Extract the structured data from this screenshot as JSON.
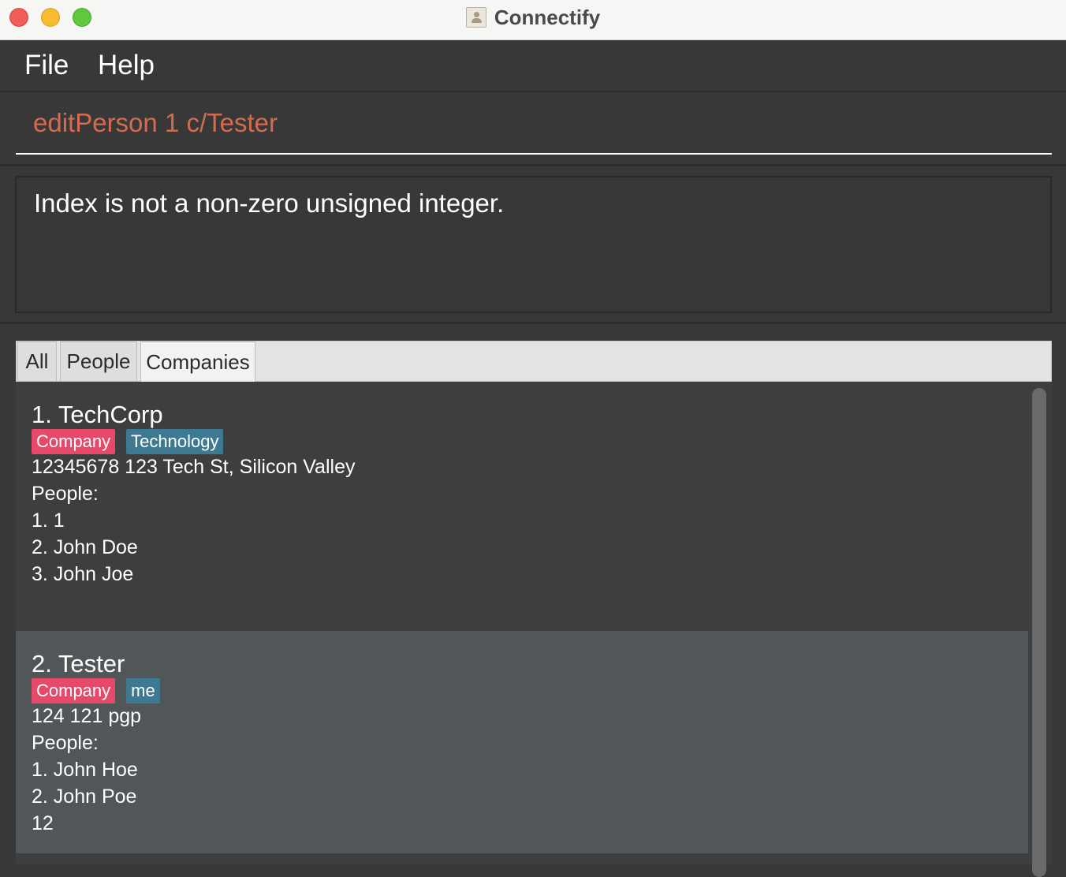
{
  "window": {
    "title": "Connectify",
    "controls": [
      "close",
      "minimize",
      "maximize"
    ]
  },
  "menu": {
    "file": "File",
    "help": "Help"
  },
  "command": {
    "value": "editPerson 1 c/Tester"
  },
  "result": {
    "message": "Index is not a non-zero unsigned integer."
  },
  "tabs": {
    "all": "All",
    "people": "People",
    "companies": "Companies",
    "selected": "Companies"
  },
  "colors": {
    "command_text": "#d46b50",
    "tag_company": "#e6496a",
    "tag_other": "#3d7a92",
    "list_bg": "#3c3e3f",
    "selected_row_bg": "#515658"
  },
  "companies": [
    {
      "title": "1.  TechCorp",
      "tags": [
        "Company",
        "Technology"
      ],
      "contact": "12345678  123 Tech St, Silicon Valley",
      "people_label": "People:",
      "people": [
        "1. 1",
        "2. John Doe",
        "3. John Joe"
      ]
    },
    {
      "title": "2.  Tester",
      "tags": [
        "Company",
        "me"
      ],
      "contact": "124  121 pgp",
      "people_label": "People:",
      "people": [
        "1. John Hoe",
        "2. John Poe",
        "12"
      ]
    }
  ]
}
